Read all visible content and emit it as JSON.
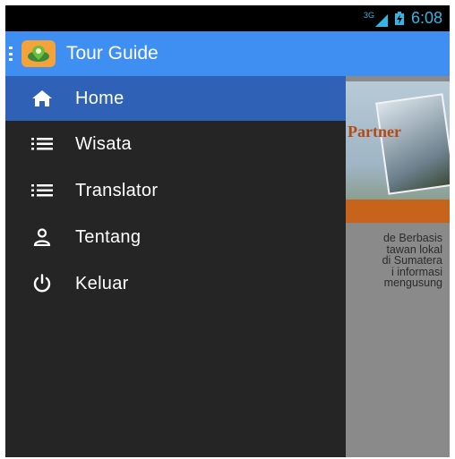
{
  "status_bar": {
    "network_type": "3G",
    "time": "6:08",
    "accent_color": "#33b5e5"
  },
  "action_bar": {
    "title": "Tour Guide",
    "color": "#3f8ff2",
    "logo_icon": "app-logo-icon"
  },
  "drawer": {
    "items": [
      {
        "label": "Home",
        "icon": "home-icon",
        "active": true
      },
      {
        "label": "Wisata",
        "icon": "list-icon",
        "active": false
      },
      {
        "label": "Translator",
        "icon": "list-icon",
        "active": false
      },
      {
        "label": "Tentang",
        "icon": "person-icon",
        "active": false
      },
      {
        "label": "Keluar",
        "icon": "power-icon",
        "active": false
      }
    ],
    "background_color": "#252525",
    "active_color": "#2f62b7"
  },
  "background_content": {
    "banner_word": "Partner",
    "text_lines": [
      "de Berbasis",
      "tawan lokal",
      "di Sumatera",
      "i informasi",
      "mengusung"
    ]
  }
}
